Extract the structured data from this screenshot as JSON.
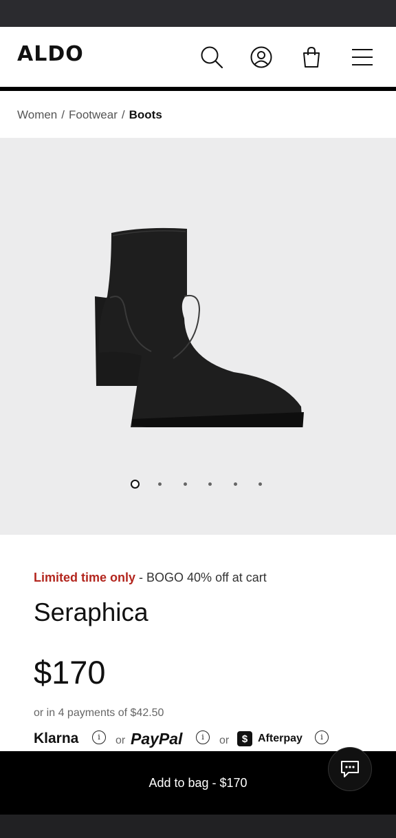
{
  "header": {
    "logo": "ALDO",
    "icons": [
      "search-icon",
      "account-icon",
      "bag-icon",
      "menu-icon"
    ]
  },
  "breadcrumb": {
    "items": [
      "Women",
      "Footwear",
      "Boots"
    ],
    "separator": "/"
  },
  "gallery": {
    "image_count": 6,
    "active_index": 0
  },
  "product": {
    "promo_highlight": "Limited time only",
    "promo_text": " - BOGO 40% off at cart",
    "name": "Seraphica",
    "price": "$170",
    "installments": "or in 4 payments of $42.50"
  },
  "payment": {
    "klarna": "Klarna",
    "paypal": "PayPal",
    "afterpay": "Afterpay",
    "or": "or",
    "info_symbol": "i",
    "afterpay_symbol": "$"
  },
  "cta": {
    "add_to_bag": "Add to bag - $170"
  },
  "colors": {
    "promo": "#b3261e",
    "cta_bg": "#000000",
    "gallery_bg": "#ececed"
  }
}
